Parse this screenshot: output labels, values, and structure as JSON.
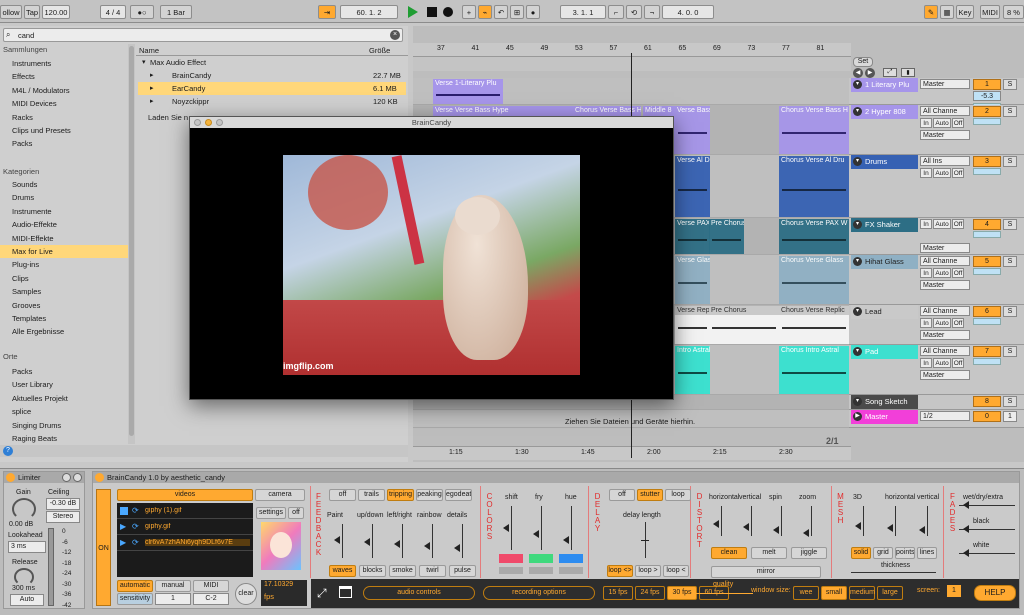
{
  "transport": {
    "follow": "ollow",
    "tap": "Tap",
    "tempo": "120.00",
    "signature": "4 / 4",
    "metronome": "●○",
    "quantize": "1 Bar",
    "position": "60.  1.  2",
    "loop_start": "3.  1.  1",
    "loop_length": "4.  0.  0",
    "key": "Key",
    "midi": "MIDI",
    "cpu": "8 %"
  },
  "browser": {
    "search_value": "cand",
    "sections": {
      "collections": "Sammlungen",
      "categories": "Kategorien",
      "places": "Orte"
    },
    "collections": [
      {
        "label": "Instruments",
        "color": "#e8392c"
      },
      {
        "label": "Effects",
        "color": "#f0a22e"
      },
      {
        "label": "M4L / Modulators",
        "color": "#f2df3b"
      },
      {
        "label": "MIDI Devices",
        "color": "#5fd35c"
      },
      {
        "label": "Racks",
        "color": "#3aa7e6"
      },
      {
        "label": "Clips und Presets",
        "color": "#b35ad8"
      },
      {
        "label": "Packs",
        "color": "#9f9f9f"
      }
    ],
    "categories": [
      "Sounds",
      "Drums",
      "Instrumente",
      "Audio-Effekte",
      "MIDI-Effekte",
      "Max for Live",
      "Plug-ins",
      "Clips",
      "Samples",
      "Grooves",
      "Templates",
      "Alle Ergebnisse"
    ],
    "places": [
      "Packs",
      "User Library",
      "Aktuelles Projekt",
      "splice",
      "Singing Drums",
      "Raging Beats"
    ],
    "columns": {
      "name": "Name",
      "size": "Größe"
    },
    "files": [
      {
        "name": "Max Audio Effect",
        "size": ""
      },
      {
        "name": "BrainCandy",
        "size": "22.7 MB"
      },
      {
        "name": "EarCandy",
        "size": "6.1 MB"
      },
      {
        "name": "Noyzckippr",
        "size": "120 KB"
      }
    ],
    "loading": "Laden Sie n"
  },
  "popup": {
    "title": "BrainCandy",
    "watermark": "imgflip.com"
  },
  "arrangement": {
    "bars": [
      "37",
      "41",
      "45",
      "49",
      "53",
      "57",
      "61",
      "65",
      "69",
      "73",
      "77",
      "81"
    ],
    "times": [
      "1:15",
      "1:30",
      "1:45",
      "2:00",
      "2:15",
      "2:30"
    ],
    "drop_hint": "Ziehen Sie Dateien und Geräte hierhin.",
    "set_label": "Set",
    "zoom": "2/1",
    "clips": [
      {
        "label": "Verse 1-Literary Plu"
      },
      {
        "label": "Verse Verse Bass Hype"
      },
      {
        "label": "Chorus Verse Bass H"
      },
      {
        "label": "Middle 8"
      },
      {
        "label": "Verse Bass"
      },
      {
        "label": "Chorus Verse Bass H"
      },
      {
        "label": "Verse Al Dr"
      },
      {
        "label": "Chorus Verse Al Dru"
      },
      {
        "label": "Verse PAX"
      },
      {
        "label": "Pre Chorus"
      },
      {
        "label": "Chorus Verse PAX W"
      },
      {
        "label": "Verse Glas"
      },
      {
        "label": "Chorus Verse Glass"
      },
      {
        "label": "Verse Repl"
      },
      {
        "label": "Pre Chorus"
      },
      {
        "label": "Chorus Verse Repl"
      },
      {
        "label": "Chorus Verse Replic"
      },
      {
        "label": "Intro Astral"
      },
      {
        "label": "Chorus Intro Astral"
      }
    ]
  },
  "tracks": [
    {
      "name": "1 Literary Plu",
      "color": "#a695ea",
      "input": "Master",
      "num": "1",
      "vol": "-5.3"
    },
    {
      "name": "2 Hyper 808",
      "color": "#a695ea",
      "input": "All Channe",
      "num": "2",
      "monitor": [
        "In",
        "Auto",
        "Off"
      ],
      "out": "Master"
    },
    {
      "name": "Drums",
      "color": "#3661b3",
      "input": "All Ins",
      "num": "3",
      "monitor": [
        "In",
        "Auto",
        "Off"
      ]
    },
    {
      "name": "FX Shaker",
      "color": "#2d6e85",
      "input": "",
      "num": "4",
      "monitor": [
        "In",
        "Auto",
        "Off"
      ],
      "out": "Master"
    },
    {
      "name": "Hihat Glass",
      "color": "#8fb0c4",
      "input": "All Channe",
      "num": "5",
      "monitor": [
        "In",
        "Auto",
        "Off"
      ],
      "out": "Master"
    },
    {
      "name": "Lead",
      "color": "#c9c9c9",
      "input": "All Channe",
      "num": "6",
      "monitor": [
        "In",
        "Auto",
        "Off"
      ],
      "out": "Master"
    },
    {
      "name": "Pad",
      "color": "#3de0cf",
      "input": "All Channe",
      "num": "7",
      "monitor": [
        "In",
        "Auto",
        "Off"
      ],
      "out": "Master"
    },
    {
      "name": "Song Sketch",
      "color": "#4a4a4a",
      "num": "8"
    },
    {
      "name": "Master",
      "color": "#f23fd9",
      "input": "1/2",
      "num": "0",
      "cpu": "1"
    }
  ],
  "limiter": {
    "title": "Limiter",
    "gain": "Gain",
    "gain_val": "0.00 dB",
    "ceiling": "Ceiling",
    "ceiling_val": "-0.30 dB",
    "stereo": "Stereo",
    "lookahead": "Lookahead",
    "lookahead_val": "3 ms",
    "release": "Release",
    "release_val": "300 ms",
    "auto": "Auto",
    "scale": [
      "0",
      "-6",
      "-12",
      "-18",
      "-24",
      "-30",
      "-36",
      "-42"
    ]
  },
  "braincandy": {
    "title": "BrainCandy 1.0 by aesthetic_candy",
    "on": "ON",
    "tabs": [
      "videos",
      "camera"
    ],
    "files": [
      "giphy (1).gif",
      "giphy.gif",
      "clr6vA7zhANi6yqh9DLf6v7E"
    ],
    "settings": "settings",
    "off": "off",
    "modes": [
      "automatic",
      "manual",
      "MIDI"
    ],
    "sensitivity": "sensitivity",
    "sens_val": "1",
    "midi_note": "C-2",
    "clear": "clear",
    "fps_val": "17.10329",
    "fps": "fps",
    "feedback": {
      "label": "FEEDBACK",
      "buttons": [
        "off",
        "trails",
        "tripping",
        "peaking",
        "egodeath"
      ],
      "params": [
        "Paint",
        "up/down",
        "left/right",
        "rainbow",
        "details"
      ],
      "modes": [
        "waves",
        "blocks",
        "smoke",
        "twirl",
        "pulse"
      ]
    },
    "colors": {
      "label": "COLORS",
      "params": [
        "shift",
        "fry",
        "hue"
      ]
    },
    "delay": {
      "label": "DELAY",
      "buttons": [
        "off",
        "stutter",
        "loop"
      ],
      "param": "delay length",
      "loops": [
        "loop <>",
        "loop >",
        "loop <"
      ]
    },
    "distort": {
      "label": "DISTORT",
      "params": [
        "horizontal",
        "vertical",
        "spin",
        "zoom"
      ],
      "buttons": [
        "clean",
        "melt",
        "jiggle"
      ],
      "mirror": "mirror"
    },
    "mesh": {
      "label": "MESH",
      "params": [
        "3D",
        "horizontal",
        "vertical"
      ],
      "buttons": [
        "solid",
        "grid",
        "points",
        "lines"
      ],
      "thickness": "thickness"
    },
    "fades": {
      "label": "FADES",
      "params": [
        "wet/dry/extra",
        "black",
        "white"
      ]
    },
    "bottom": {
      "audio": "audio controls",
      "recording": "recording options",
      "fps_opts": [
        "15 fps",
        "24 fps",
        "30 fps",
        "60 fps"
      ],
      "quality": "quality",
      "window": "window size:",
      "sizes": [
        "wee",
        "small",
        "medium",
        "large"
      ],
      "screen": "screen:",
      "screen_val": "1",
      "help": "HELP"
    }
  }
}
